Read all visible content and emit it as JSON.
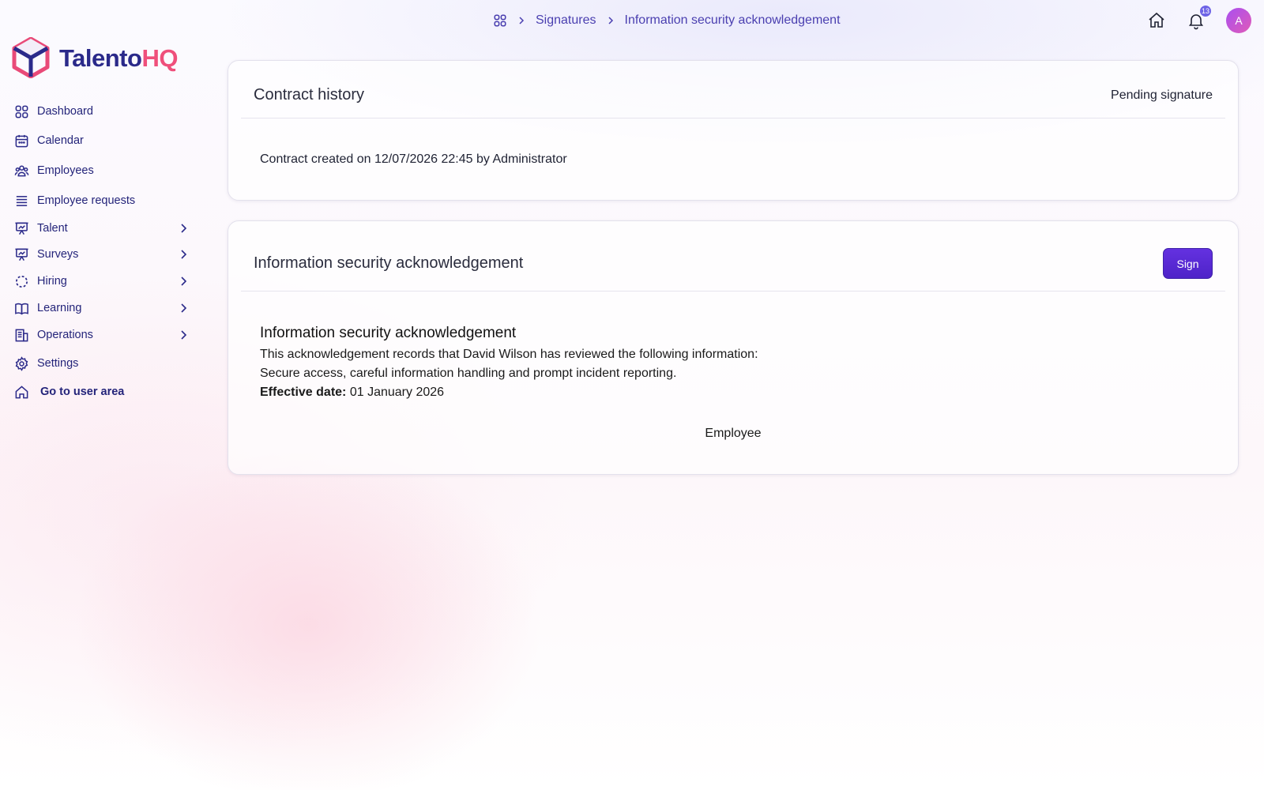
{
  "app": {
    "brand_part1": "Talento",
    "brand_part2": "HQ"
  },
  "sidebar": {
    "items": [
      {
        "label": "Dashboard",
        "icon": "grid-icon"
      },
      {
        "label": "Calendar",
        "icon": "calendar-icon"
      },
      {
        "label": "Employees",
        "icon": "users-icon"
      },
      {
        "label": "Employee requests",
        "icon": "list-icon"
      },
      {
        "label": "Talent",
        "icon": "presentation-icon",
        "expandable": true
      },
      {
        "label": "Surveys",
        "icon": "presentation-icon",
        "expandable": true
      },
      {
        "label": "Hiring",
        "icon": "dashed-circle-icon",
        "expandable": true
      },
      {
        "label": "Learning",
        "icon": "book-icon",
        "expandable": true
      },
      {
        "label": "Operations",
        "icon": "building-icon",
        "expandable": true
      },
      {
        "label": "Settings",
        "icon": "gear-icon"
      },
      {
        "label": "Go to user area",
        "icon": "home-icon"
      }
    ]
  },
  "header": {
    "breadcrumb": [
      "Signatures",
      "Information security acknowledgement"
    ],
    "notification_count": "13",
    "avatar_initial": "A"
  },
  "history_card": {
    "title": "Contract history",
    "status": "Pending signature",
    "entry": "Contract created on 12/07/2026 22:45 by Administrator"
  },
  "document_card": {
    "title": "Information security acknowledgement",
    "sign_label": "Sign",
    "doc_title": "Information security acknowledgement",
    "line1": "This acknowledgement records that David Wilson has reviewed the following information:",
    "line2": "Secure access, careful information handling and prompt incident reporting.",
    "effective_label": "Effective date:",
    "effective_value": "01 January 2026",
    "signer_role": "Employee"
  },
  "colors": {
    "brand_navy": "#2b2a8a",
    "brand_pink": "#ef4f7b",
    "nav_text": "#24247a",
    "button_purple": "#5a2ad6"
  }
}
